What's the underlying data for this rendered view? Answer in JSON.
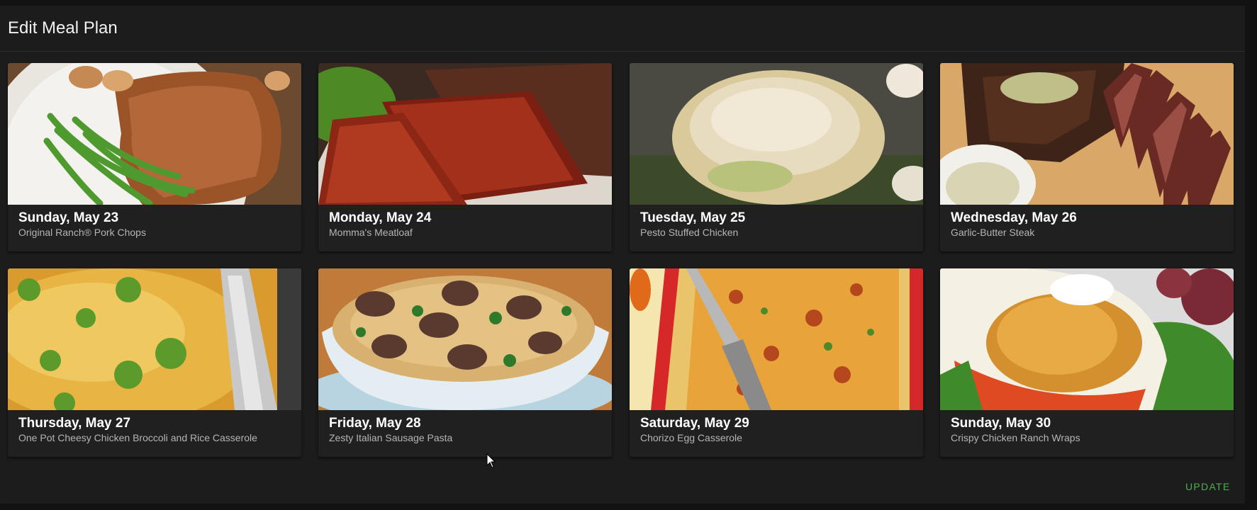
{
  "dialog": {
    "title": "Edit Meal Plan",
    "update_label": "UPDATE"
  },
  "colors": {
    "background": "#1c1c1c",
    "card": "#202020",
    "accent": "#4caf50"
  },
  "meals": [
    {
      "day": "Sunday, May 23",
      "name": "Original Ranch® Pork Chops"
    },
    {
      "day": "Monday, May 24",
      "name": "Momma's Meatloaf"
    },
    {
      "day": "Tuesday, May 25",
      "name": "Pesto Stuffed Chicken"
    },
    {
      "day": "Wednesday, May 26",
      "name": "Garlic-Butter Steak"
    },
    {
      "day": "Thursday, May 27",
      "name": "One Pot Cheesy Chicken Broccoli and Rice Casserole"
    },
    {
      "day": "Friday, May 28",
      "name": "Zesty Italian Sausage Pasta"
    },
    {
      "day": "Saturday, May 29",
      "name": "Chorizo Egg Casserole"
    },
    {
      "day": "Sunday, May 30",
      "name": "Crispy Chicken Ranch Wraps"
    }
  ]
}
